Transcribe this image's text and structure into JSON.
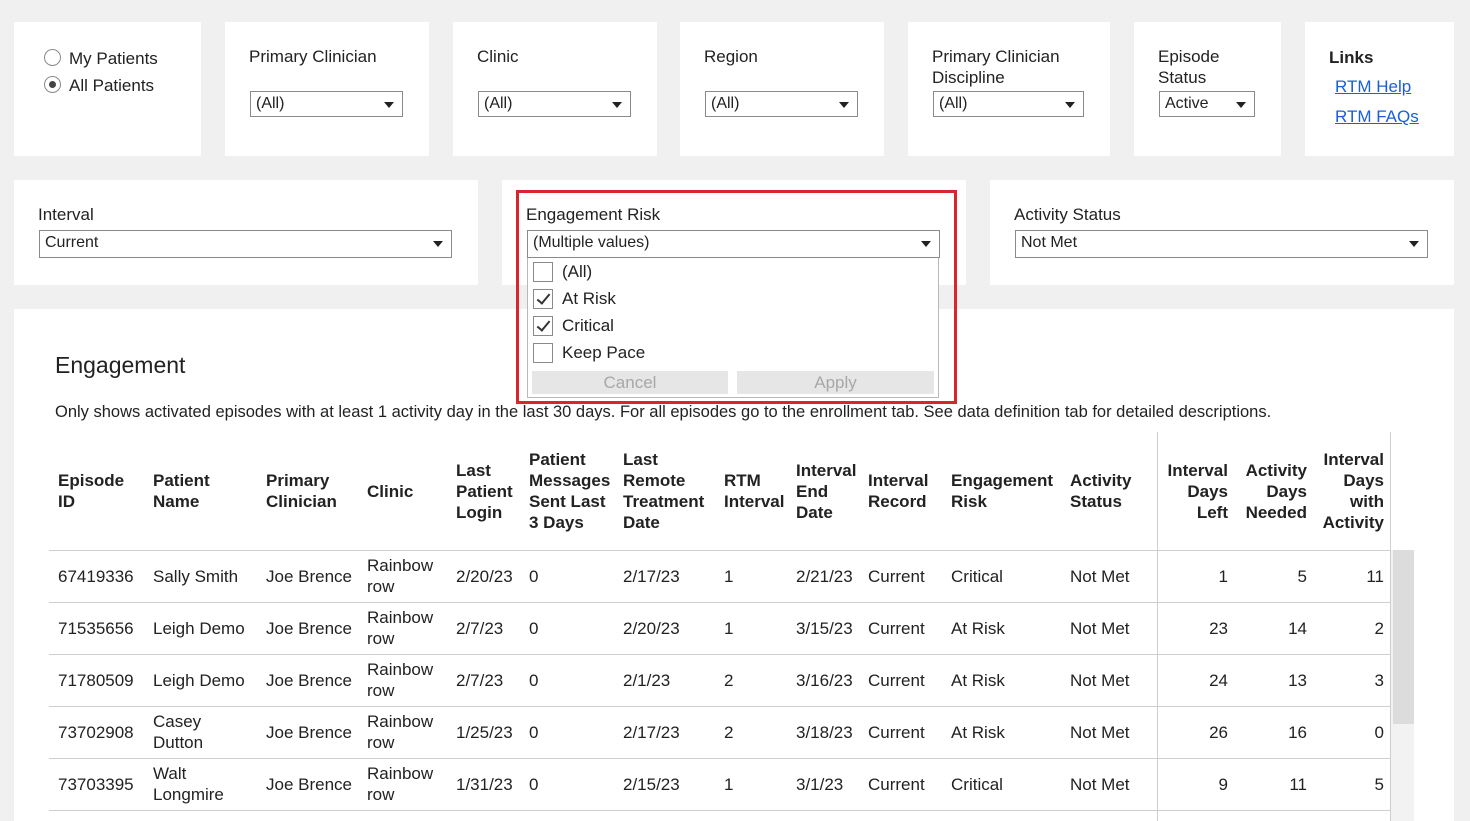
{
  "filters": {
    "patients": {
      "options": [
        "My Patients",
        "All Patients"
      ],
      "selected": "All Patients"
    },
    "primary_clinician": {
      "label": "Primary Clinician",
      "value": "(All)"
    },
    "clinic": {
      "label": "Clinic",
      "value": "(All)"
    },
    "region": {
      "label": "Region",
      "value": "(All)"
    },
    "discipline": {
      "label_line1": "Primary Clinician",
      "label_line2": "Discipline",
      "value": "(All)"
    },
    "episode_status": {
      "label_line1": "Episode",
      "label_line2": "Status",
      "value": "Active"
    },
    "links": {
      "title": "Links",
      "help": "RTM Help",
      "faqs": "RTM FAQs"
    },
    "interval": {
      "label": "Interval",
      "value": "Current"
    },
    "engagement_risk": {
      "label": "Engagement Risk",
      "value": "(Multiple values)",
      "options": [
        {
          "label": "(All)",
          "checked": false
        },
        {
          "label": "At Risk",
          "checked": true
        },
        {
          "label": "Critical",
          "checked": true
        },
        {
          "label": "Keep Pace",
          "checked": false
        }
      ],
      "cancel": "Cancel",
      "apply": "Apply"
    },
    "activity_status": {
      "label": "Activity Status",
      "value": "Not Met"
    }
  },
  "engagement": {
    "title": "Engagement",
    "description": "Only shows activated episodes with at least 1 activity day in the last 30 days. For all episodes go to the enrollment tab. See data definition tab for detailed descriptions.",
    "columns": [
      [
        "Episode",
        "ID"
      ],
      [
        "Patient",
        "Name"
      ],
      [
        "Primary",
        "Clinician"
      ],
      [
        "Clinic"
      ],
      [
        "Last",
        "Patient",
        "Login"
      ],
      [
        "Patient",
        "Messages",
        "Sent Last",
        "3 Days"
      ],
      [
        "Last",
        "Remote",
        "Treatment",
        "Date"
      ],
      [
        "RTM",
        "Interval"
      ],
      [
        "Interval",
        "End",
        "Date"
      ],
      [
        "Interval",
        "Record"
      ],
      [
        "Engagement",
        "Risk"
      ],
      [
        "Activity",
        "Status"
      ],
      [
        "Interval",
        "Days",
        "Left"
      ],
      [
        "Activity",
        "Days",
        "Needed"
      ],
      [
        "Interval",
        "Days",
        "with",
        "Activity"
      ]
    ],
    "rows": [
      {
        "episode_id": "67419336",
        "patient": [
          "Sally Smith"
        ],
        "clinician": "Joe Brence",
        "clinic": [
          "Rainbow",
          "row"
        ],
        "last_login": "2/20/23",
        "messages": "0",
        "last_treatment": "2/17/23",
        "rtm_interval": "1",
        "interval_end": "2/21/23",
        "interval_record": "Current",
        "risk": "Critical",
        "activity_status": "Not Met",
        "days_left": "1",
        "days_needed": "5",
        "days_with_activity": "11"
      },
      {
        "episode_id": "71535656",
        "patient": [
          "Leigh Demo"
        ],
        "clinician": "Joe Brence",
        "clinic": [
          "Rainbow",
          "row"
        ],
        "last_login": "2/7/23",
        "messages": "0",
        "last_treatment": "2/20/23",
        "rtm_interval": "1",
        "interval_end": "3/15/23",
        "interval_record": "Current",
        "risk": "At Risk",
        "activity_status": "Not Met",
        "days_left": "23",
        "days_needed": "14",
        "days_with_activity": "2"
      },
      {
        "episode_id": "71780509",
        "patient": [
          "Leigh Demo"
        ],
        "clinician": "Joe Brence",
        "clinic": [
          "Rainbow",
          "row"
        ],
        "last_login": "2/7/23",
        "messages": "0",
        "last_treatment": "2/1/23",
        "rtm_interval": "2",
        "interval_end": "3/16/23",
        "interval_record": "Current",
        "risk": "At Risk",
        "activity_status": "Not Met",
        "days_left": "24",
        "days_needed": "13",
        "days_with_activity": "3"
      },
      {
        "episode_id": "73702908",
        "patient": [
          "Casey",
          "Dutton"
        ],
        "clinician": "Joe Brence",
        "clinic": [
          "Rainbow",
          "row"
        ],
        "last_login": "1/25/23",
        "messages": "0",
        "last_treatment": "2/17/23",
        "rtm_interval": "2",
        "interval_end": "3/18/23",
        "interval_record": "Current",
        "risk": "At Risk",
        "activity_status": "Not Met",
        "days_left": "26",
        "days_needed": "16",
        "days_with_activity": "0"
      },
      {
        "episode_id": "73703395",
        "patient": [
          "Walt",
          "Longmire"
        ],
        "clinician": "Joe Brence",
        "clinic": [
          "Rainbow",
          "row"
        ],
        "last_login": "1/31/23",
        "messages": "0",
        "last_treatment": "2/15/23",
        "rtm_interval": "1",
        "interval_end": "3/1/23",
        "interval_record": "Current",
        "risk": "Critical",
        "activity_status": "Not Met",
        "days_left": "9",
        "days_needed": "11",
        "days_with_activity": "5"
      }
    ]
  }
}
